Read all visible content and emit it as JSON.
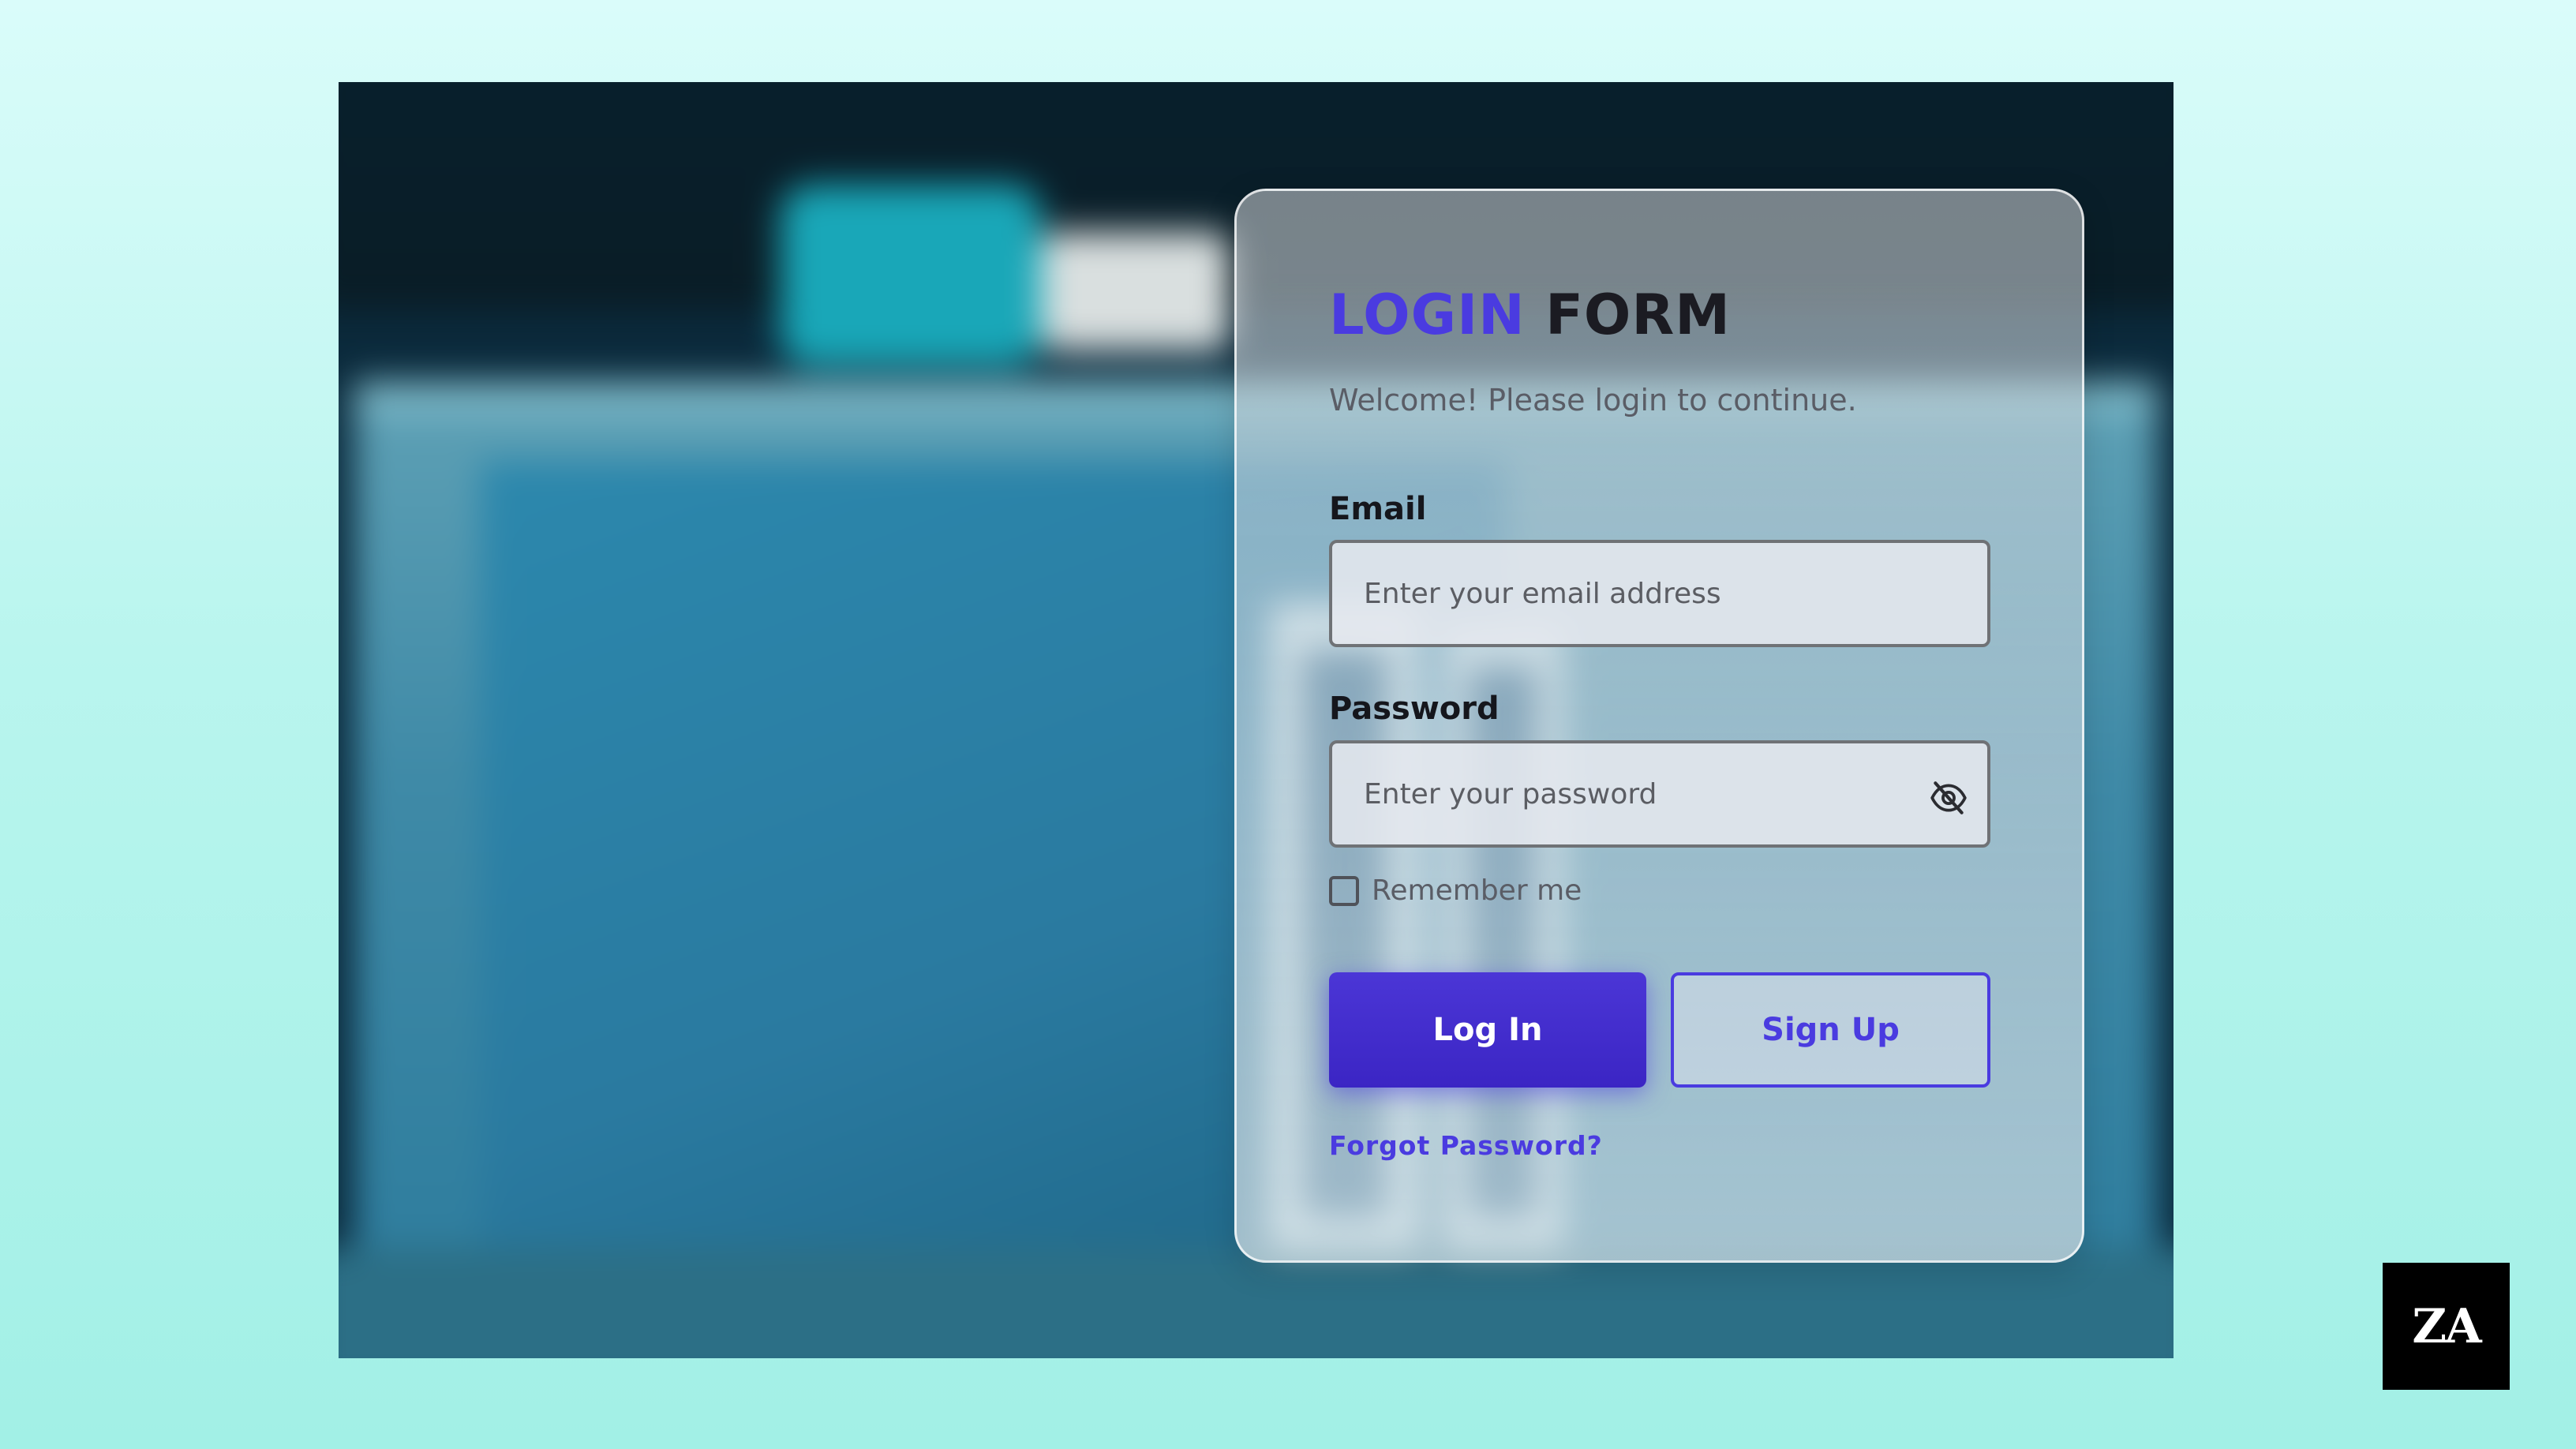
{
  "form": {
    "title_accent": "LOGIN",
    "title_rest": "FORM",
    "subtitle": "Welcome! Please login to continue.",
    "email": {
      "label": "Email",
      "placeholder": "Enter your email address",
      "value": ""
    },
    "password": {
      "label": "Password",
      "placeholder": "Enter your password",
      "value": "",
      "toggle_icon": "eye-off-icon"
    },
    "remember_label": "Remember me",
    "remember_checked": false,
    "login_button": "Log In",
    "signup_button": "Sign Up",
    "forgot_link": "Forgot Password?"
  },
  "badge": {
    "logo_text": "ZA"
  },
  "colors": {
    "accent": "#4a3be0",
    "background_top": "#dafcfa",
    "background_bottom": "#a2f0e6"
  }
}
